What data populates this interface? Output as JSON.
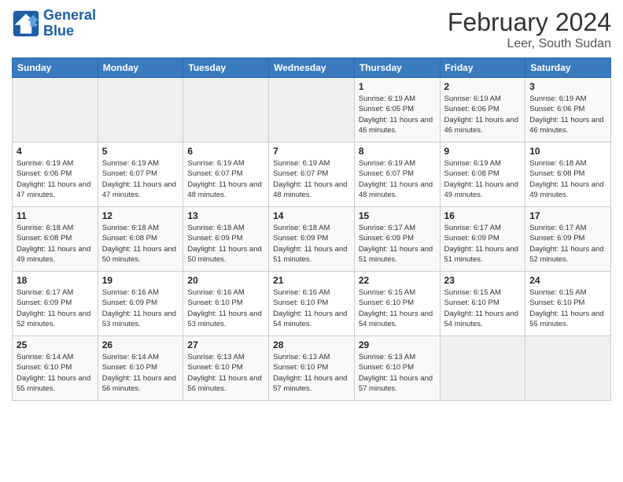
{
  "logo": {
    "line1": "General",
    "line2": "Blue"
  },
  "title": "February 2024",
  "location": "Leer, South Sudan",
  "weekdays": [
    "Sunday",
    "Monday",
    "Tuesday",
    "Wednesday",
    "Thursday",
    "Friday",
    "Saturday"
  ],
  "weeks": [
    [
      {
        "day": "",
        "info": ""
      },
      {
        "day": "",
        "info": ""
      },
      {
        "day": "",
        "info": ""
      },
      {
        "day": "",
        "info": ""
      },
      {
        "day": "1",
        "info": "Sunrise: 6:19 AM\nSunset: 6:05 PM\nDaylight: 11 hours and 46 minutes."
      },
      {
        "day": "2",
        "info": "Sunrise: 6:19 AM\nSunset: 6:06 PM\nDaylight: 11 hours and 46 minutes."
      },
      {
        "day": "3",
        "info": "Sunrise: 6:19 AM\nSunset: 6:06 PM\nDaylight: 11 hours and 46 minutes."
      }
    ],
    [
      {
        "day": "4",
        "info": "Sunrise: 6:19 AM\nSunset: 6:06 PM\nDaylight: 11 hours and 47 minutes."
      },
      {
        "day": "5",
        "info": "Sunrise: 6:19 AM\nSunset: 6:07 PM\nDaylight: 11 hours and 47 minutes."
      },
      {
        "day": "6",
        "info": "Sunrise: 6:19 AM\nSunset: 6:07 PM\nDaylight: 11 hours and 48 minutes."
      },
      {
        "day": "7",
        "info": "Sunrise: 6:19 AM\nSunset: 6:07 PM\nDaylight: 11 hours and 48 minutes."
      },
      {
        "day": "8",
        "info": "Sunrise: 6:19 AM\nSunset: 6:07 PM\nDaylight: 11 hours and 48 minutes."
      },
      {
        "day": "9",
        "info": "Sunrise: 6:19 AM\nSunset: 6:08 PM\nDaylight: 11 hours and 49 minutes."
      },
      {
        "day": "10",
        "info": "Sunrise: 6:18 AM\nSunset: 6:08 PM\nDaylight: 11 hours and 49 minutes."
      }
    ],
    [
      {
        "day": "11",
        "info": "Sunrise: 6:18 AM\nSunset: 6:08 PM\nDaylight: 11 hours and 49 minutes."
      },
      {
        "day": "12",
        "info": "Sunrise: 6:18 AM\nSunset: 6:08 PM\nDaylight: 11 hours and 50 minutes."
      },
      {
        "day": "13",
        "info": "Sunrise: 6:18 AM\nSunset: 6:09 PM\nDaylight: 11 hours and 50 minutes."
      },
      {
        "day": "14",
        "info": "Sunrise: 6:18 AM\nSunset: 6:09 PM\nDaylight: 11 hours and 51 minutes."
      },
      {
        "day": "15",
        "info": "Sunrise: 6:17 AM\nSunset: 6:09 PM\nDaylight: 11 hours and 51 minutes."
      },
      {
        "day": "16",
        "info": "Sunrise: 6:17 AM\nSunset: 6:09 PM\nDaylight: 11 hours and 51 minutes."
      },
      {
        "day": "17",
        "info": "Sunrise: 6:17 AM\nSunset: 6:09 PM\nDaylight: 11 hours and 52 minutes."
      }
    ],
    [
      {
        "day": "18",
        "info": "Sunrise: 6:17 AM\nSunset: 6:09 PM\nDaylight: 11 hours and 52 minutes."
      },
      {
        "day": "19",
        "info": "Sunrise: 6:16 AM\nSunset: 6:09 PM\nDaylight: 11 hours and 53 minutes."
      },
      {
        "day": "20",
        "info": "Sunrise: 6:16 AM\nSunset: 6:10 PM\nDaylight: 11 hours and 53 minutes."
      },
      {
        "day": "21",
        "info": "Sunrise: 6:16 AM\nSunset: 6:10 PM\nDaylight: 11 hours and 54 minutes."
      },
      {
        "day": "22",
        "info": "Sunrise: 6:15 AM\nSunset: 6:10 PM\nDaylight: 11 hours and 54 minutes."
      },
      {
        "day": "23",
        "info": "Sunrise: 6:15 AM\nSunset: 6:10 PM\nDaylight: 11 hours and 54 minutes."
      },
      {
        "day": "24",
        "info": "Sunrise: 6:15 AM\nSunset: 6:10 PM\nDaylight: 11 hours and 55 minutes."
      }
    ],
    [
      {
        "day": "25",
        "info": "Sunrise: 6:14 AM\nSunset: 6:10 PM\nDaylight: 11 hours and 55 minutes."
      },
      {
        "day": "26",
        "info": "Sunrise: 6:14 AM\nSunset: 6:10 PM\nDaylight: 11 hours and 56 minutes."
      },
      {
        "day": "27",
        "info": "Sunrise: 6:13 AM\nSunset: 6:10 PM\nDaylight: 11 hours and 56 minutes."
      },
      {
        "day": "28",
        "info": "Sunrise: 6:13 AM\nSunset: 6:10 PM\nDaylight: 11 hours and 57 minutes."
      },
      {
        "day": "29",
        "info": "Sunrise: 6:13 AM\nSunset: 6:10 PM\nDaylight: 11 hours and 57 minutes."
      },
      {
        "day": "",
        "info": ""
      },
      {
        "day": "",
        "info": ""
      }
    ]
  ]
}
